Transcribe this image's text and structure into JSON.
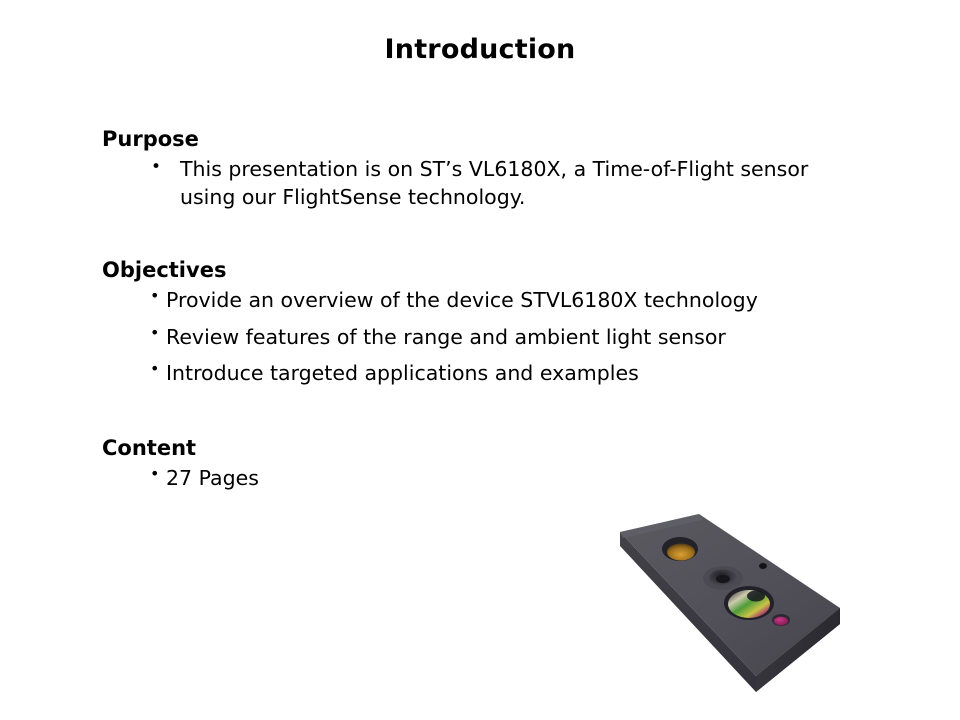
{
  "slide": {
    "title": "Introduction",
    "sections": [
      {
        "heading": "Purpose",
        "bullets": [
          "This presentation is on ST’s VL6180X, a Time-of-Flight sensor using our FlightSense technology."
        ]
      },
      {
        "heading": "Objectives",
        "bullets": [
          "Provide an overview of the device STVL6180X technology",
          "Review features of the range and ambient light sensor",
          "Introduce targeted applications and examples"
        ]
      },
      {
        "heading": "Content",
        "bullets": [
          "27 Pages"
        ]
      }
    ]
  },
  "figure": {
    "name": "vl6180x-sensor-module-photo",
    "description": "Dark gray rectangular proximity sensor module shown at an angle",
    "colors": {
      "body_top": "#55545a",
      "body_top_dark": "#4a4950",
      "body_side_front": "#3c3b41",
      "body_side_right": "#2e2d33",
      "aperture_gold": "#c08a24",
      "aperture_ring": "#4e4d54",
      "aperture_pinhole": "#141418",
      "lens_green": "#4f9b3a",
      "lens_magenta": "#a8246e",
      "lens_yellow": "#c8c447",
      "dot_magenta": "#a01e63"
    }
  }
}
